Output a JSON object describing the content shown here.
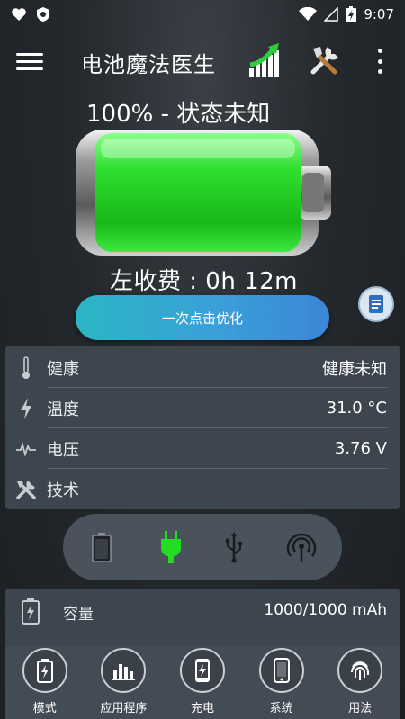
{
  "status_bar": {
    "time": "9:07"
  },
  "app_bar": {
    "title": "电池魔法医生"
  },
  "battery": {
    "status_text": "100% - 状态未知",
    "level": 1.0,
    "time_left": "左收费 :  0h 12m"
  },
  "optimize_button": {
    "label": "一次点击优化"
  },
  "info_rows": [
    {
      "label": "健康",
      "value": "健康未知",
      "icon": "thermometer-icon"
    },
    {
      "label": "温度",
      "value": "31.0 °C",
      "icon": "lightning-icon"
    },
    {
      "label": "电压",
      "value": "3.76 V",
      "icon": "pulse-icon"
    },
    {
      "label": "技术",
      "value": "",
      "icon": "tools-icon"
    }
  ],
  "mode_bar": {
    "items": [
      "battery-icon",
      "plug-icon",
      "usb-icon",
      "wireless-icon"
    ],
    "active": "plug-icon"
  },
  "capacity": {
    "label": "容量",
    "value": "1000/1000 mAh"
  },
  "bottom_nav": [
    {
      "label": "模式",
      "icon": "battery-bolt-icon"
    },
    {
      "label": "应用程序",
      "icon": "bar-chart-icon"
    },
    {
      "label": "充电",
      "icon": "charging-phone-icon"
    },
    {
      "label": "系统",
      "icon": "phone-icon"
    },
    {
      "label": "用法",
      "icon": "fingerprint-icon"
    }
  ],
  "colors": {
    "accent_green": "#22dd22",
    "button_start": "#2bb6c4",
    "button_end": "#3c86d6",
    "panel": "#3d454e"
  }
}
